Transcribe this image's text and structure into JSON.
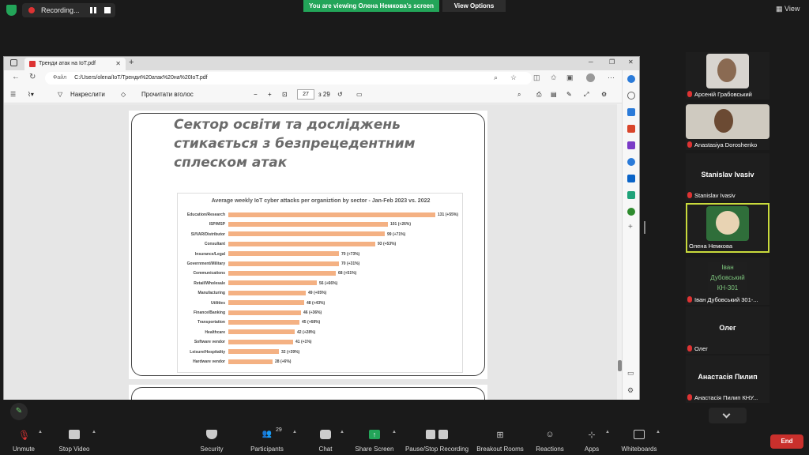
{
  "zoom": {
    "recording_text": "Recording...",
    "viewing_banner": "You are viewing Олена Немкова's screen",
    "view_options": "View Options",
    "view_button": "View"
  },
  "browser": {
    "tab_title": "Тренди атак на IoT.pdf",
    "url_label": "Файл",
    "url": "C:/Users/olena/IoT/Тренди%20атак%20на%20IoT.pdf",
    "toolbar": {
      "draw_label": "Накреслити",
      "read_aloud_label": "Прочитати вголос",
      "page_current": "27",
      "page_total": "з 29",
      "zoom_minus": "−",
      "zoom_plus": "+"
    }
  },
  "slide": {
    "title_line1": "Сектор освіти та досліджень",
    "title_line2": "стикається з безпрецедентним",
    "title_line3": "сплеском атак"
  },
  "chart_data": {
    "type": "bar",
    "orientation": "horizontal",
    "title": "Average weekly IoT cyber attacks per organiztion by sector - Jan-Feb 2023 vs. 2022",
    "categories": [
      "Education/Research",
      "ISP/MSP",
      "SI/VAR/Distributor",
      "Consultant",
      "Insurance/Legal",
      "Government/Military",
      "Communications",
      "Retail/Wholesale",
      "Manufacturing",
      "Utilities",
      "Finance/Banking",
      "Transportation",
      "Healthcare",
      "Software vendor",
      "Leisure/Hospitality",
      "Hardware vendor"
    ],
    "values": [
      131,
      101,
      99,
      93,
      70,
      70,
      68,
      56,
      49,
      48,
      46,
      45,
      42,
      41,
      32,
      28
    ],
    "data_labels": [
      "131 (+55%)",
      "101 (+26%)",
      "99 (+71%)",
      "93 (+53%)",
      "70 (+73%)",
      "70 (+31%)",
      "68 (+51%)",
      "56 (+66%)",
      "49 (+05%)",
      "48 (+43%)",
      "46 (+36%)",
      "45 (+68%)",
      "42 (+28%)",
      "41 (+1%)",
      "32 (+39%)",
      "28 (+6%)"
    ],
    "bar_color": "#f4b183"
  },
  "participants": [
    {
      "name": "Арсеній Грабовський",
      "muted": true
    },
    {
      "name": "Anastasiya Doroshenko",
      "muted": true
    },
    {
      "name": "Stanislav Ivasiv",
      "display": "Stanislav Ivasiv",
      "muted": true
    },
    {
      "name": "Олена Немкова",
      "muted": true
    },
    {
      "name": "Іван Дубовський 301-...",
      "tag_line1": "Іван",
      "tag_line2": "Дубовський",
      "tag_line3": "КН-301",
      "muted": true
    },
    {
      "name": "Олег",
      "display": "Олег",
      "muted": true
    },
    {
      "name": "Анастасія Пилип КНУ...",
      "display": "Анастасія Пилип",
      "muted": true
    }
  ],
  "toolbar": {
    "unmute": "Unmute",
    "stop_video": "Stop Video",
    "security": "Security",
    "participants": "Participants",
    "participants_count": "29",
    "chat": "Chat",
    "share_screen": "Share Screen",
    "pause_stop_recording": "Pause/Stop Recording",
    "breakout_rooms": "Breakout Rooms",
    "reactions": "Reactions",
    "apps": "Apps",
    "whiteboards": "Whiteboards",
    "end": "End"
  }
}
